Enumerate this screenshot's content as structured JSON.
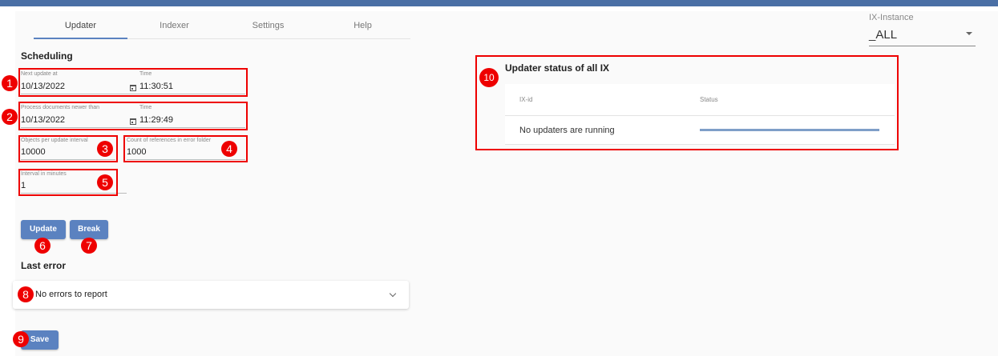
{
  "colors": {
    "topbar": "#4a6fa5",
    "tab_ink": "#5b82c0",
    "button": "#5b82c0",
    "annotation": "#e00000",
    "progress": "#7f9ec8"
  },
  "tabs": [
    {
      "label": "Updater",
      "active": true
    },
    {
      "label": "Indexer",
      "active": false
    },
    {
      "label": "Settings",
      "active": false
    },
    {
      "label": "Help",
      "active": false
    }
  ],
  "instance": {
    "label": "IX-Instance",
    "value": "_ALL"
  },
  "scheduling": {
    "title": "Scheduling",
    "next_update": {
      "label": "Next update at",
      "date": "10/13/2022",
      "time_label": "Time",
      "time": "11:30:51"
    },
    "process_newer": {
      "label": "Process documents newer than",
      "date": "10/13/2022",
      "time_label": "Time",
      "time": "11:29:49"
    },
    "objects_per_interval": {
      "label": "Objects per update interval",
      "value": "10000"
    },
    "error_refs": {
      "label": "Count of references in error folder",
      "value": "1000"
    },
    "interval_minutes": {
      "label": "Interval in minutes",
      "value": "1"
    }
  },
  "buttons": {
    "update": "Update",
    "break": "Break",
    "save": "Save"
  },
  "last_error": {
    "title": "Last error",
    "message": "No errors to report"
  },
  "status": {
    "title": "Updater status of all IX",
    "columns": [
      "IX-id",
      "Status"
    ],
    "empty_message": "No updaters are running"
  },
  "badges": [
    "1",
    "2",
    "3",
    "4",
    "5",
    "6",
    "7",
    "8",
    "9",
    "10"
  ]
}
